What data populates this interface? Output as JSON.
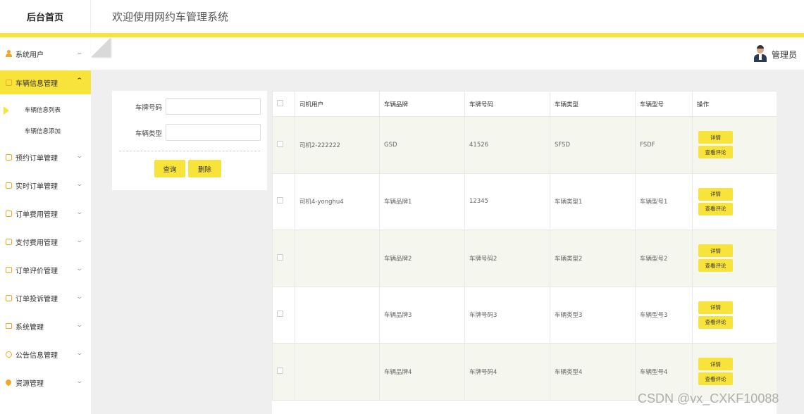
{
  "header": {
    "brand": "后台首页",
    "title": "欢迎使用网约车管理系统"
  },
  "topbar": {
    "admin_name": "管理员"
  },
  "sidebar": {
    "items": [
      {
        "label": "系统用户",
        "icon": "user-icon"
      },
      {
        "label": "车辆信息管理",
        "icon": "edit-icon",
        "active": true
      },
      {
        "label": "预约订单管理",
        "icon": "edit-icon"
      },
      {
        "label": "实时订单管理",
        "icon": "edit-icon"
      },
      {
        "label": "订单费用管理",
        "icon": "edit-icon"
      },
      {
        "label": "支付费用管理",
        "icon": "edit-icon"
      },
      {
        "label": "订单评价管理",
        "icon": "edit-icon"
      },
      {
        "label": "订单投诉管理",
        "icon": "edit-icon"
      },
      {
        "label": "系统管理",
        "icon": "image-icon"
      },
      {
        "label": "公告信息管理",
        "icon": "info-icon"
      },
      {
        "label": "资源管理",
        "icon": "pin-icon"
      }
    ],
    "sub_items": [
      {
        "label": "车辆信息列表",
        "active": true
      },
      {
        "label": "车辆信息添加"
      }
    ]
  },
  "search": {
    "plate_label": "车牌号码",
    "plate_value": "",
    "type_label": "车辆类型",
    "type_value": "",
    "query_button": "查询",
    "delete_button": "删除"
  },
  "table": {
    "columns": [
      "司机用户",
      "车辆品牌",
      "车牌号码",
      "车辆类型",
      "车辆型号",
      "操作"
    ],
    "rows": [
      {
        "driver": "司机2-222222",
        "brand": "GSD",
        "plate": "41526",
        "type": "SFSD",
        "model": "FSDF"
      },
      {
        "driver": "司机4-yonghu4",
        "brand": "车辆品牌1",
        "plate": "12345",
        "type": "车辆类型1",
        "model": "车辆型号1"
      },
      {
        "driver": "",
        "brand": "车辆品牌2",
        "plate": "车牌号码2",
        "type": "车辆类型2",
        "model": "车辆型号2"
      },
      {
        "driver": "",
        "brand": "车辆品牌3",
        "plate": "车牌号码3",
        "type": "车辆类型3",
        "model": "车辆型号3"
      },
      {
        "driver": "",
        "brand": "车辆品牌4",
        "plate": "车牌号码4",
        "type": "车辆类型4",
        "model": "车辆型号4"
      }
    ],
    "detail_button": "详情",
    "review_button": "查看评论"
  },
  "watermark": "CSDN @vx_CXKF10088",
  "colors": {
    "accent": "#f8e33a",
    "icon": "#f5a623",
    "stripe": "#f5f7ee"
  }
}
